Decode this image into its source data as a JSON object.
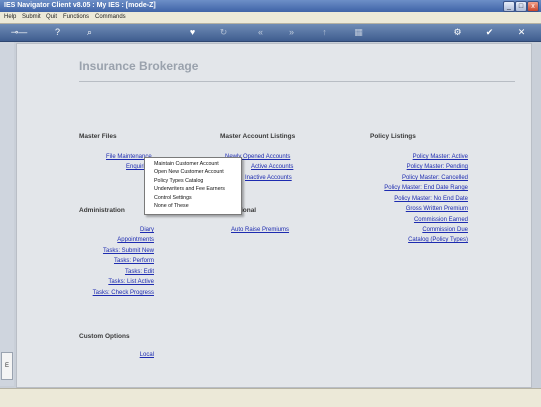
{
  "window": {
    "title": "IES Navigator Client v8.05 : My IES :      [mode-Z]",
    "buttons": [
      "_",
      "□",
      "x"
    ]
  },
  "menu": [
    "Help",
    "Submit",
    "Quit",
    "Functions",
    "Commands"
  ],
  "toolbar_icons": [
    "key-icon",
    "help-icon",
    "search-icon",
    "heart-icon",
    "refresh-icon",
    "first-icon",
    "last-icon",
    "up-icon",
    "grid-icon",
    "gear-icon",
    "ok-icon",
    "close-icon"
  ],
  "page": {
    "title": "Insurance Brokerage"
  },
  "master_files": {
    "header": "Master Files",
    "links": [
      "File Maintenance",
      "Enquiries"
    ]
  },
  "master_account_listings": {
    "header": "Master Account Listings",
    "links": [
      "Newly Opened Accounts",
      "Active Accounts",
      "Inactive Accounts"
    ]
  },
  "policy_listings": {
    "header": "Policy Listings",
    "links": [
      "Policy Master: Active",
      "Policy Master: Pending",
      "Policy Master: Cancelled",
      "Policy Master: End Date Range",
      "Policy Master: No End Date",
      "Gross Written Premium",
      "Commission Earned",
      "Commission Due",
      "Catalog (Policy Types)"
    ]
  },
  "administration": {
    "header": "Administration",
    "links": [
      "Diary",
      "Appointments",
      "Tasks: Submit New",
      "Tasks: Perform",
      "Tasks: Edit",
      "Tasks: List Active",
      "Tasks: Check Progress"
    ]
  },
  "operational": {
    "header": "Operational",
    "links": [
      "Auto Raise Premiums"
    ]
  },
  "custom_options": {
    "header": "Custom Options",
    "links": [
      "Local"
    ]
  },
  "popup_menu": {
    "items": [
      "Maintain Customer Account",
      "Open New Customer Account",
      "Policy Types Catalog",
      "Underwriters and Fee Earners",
      "Control Settings",
      "None of These"
    ]
  },
  "sidebar": {
    "tab_label": "E"
  }
}
